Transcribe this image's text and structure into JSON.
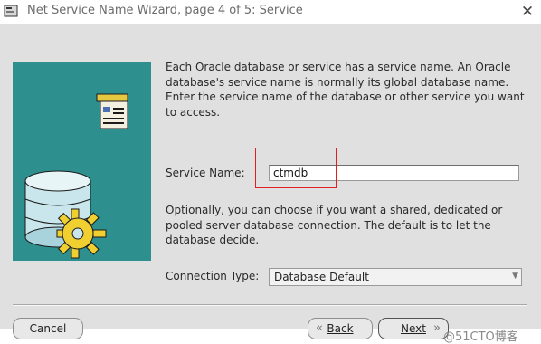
{
  "window": {
    "title": "Net Service Name Wizard, page 4 of 5: Service",
    "close_glyph": "✕"
  },
  "content": {
    "description": "Each Oracle database or service has a service name. An Oracle database's service name is normally its global database name. Enter the service name of the database or other service you want to access.",
    "service_name_label": "Service Name:",
    "service_name_value": "ctmdb",
    "connection_description": "Optionally, you can choose if you want a shared, dedicated or pooled server database connection. The default is to let the database decide.",
    "connection_type_label": "Connection Type:",
    "connection_type_value": "Database Default"
  },
  "buttons": {
    "cancel": "Cancel",
    "back": "Back",
    "next": "Next"
  },
  "watermark": "@51CTO博客",
  "icons": {
    "app": "wizard-app-icon",
    "illustration": [
      "document-icon",
      "database-icon",
      "gear-icon"
    ],
    "highlight_color": "#e02020"
  }
}
